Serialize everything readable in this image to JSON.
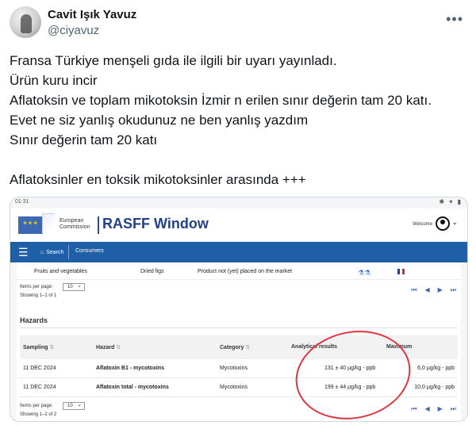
{
  "tweet": {
    "display_name": "Cavit Işık Yavuz",
    "handle": "@ciyavuz",
    "more_icon": "more-horizontal-icon",
    "text_lines": [
      "Fransa Türkiye menşeli gıda ile ilgili bir uyarı yayınladı.",
      "Ürün kuru incir",
      "Aflatoksin ve toplam mikotoksin İzmir n erilen sınır değerin tam 20 katı.",
      "Evet ne siz yanlış okudunuz ne ben yanlış yazdım",
      "Sınır değerin tam 20 katı",
      "",
      "Aflatoksinler en toksik mikotoksinler arasında +++"
    ]
  },
  "screenshot": {
    "status_time": "01:31",
    "status_icons": "✱ ▾ ▮",
    "ec_logo_line1": "European",
    "ec_logo_line2": "Commission",
    "app_title": "RASFF Window",
    "welcome": "Welcome",
    "nav": {
      "search": "Search",
      "consumers": "Consumers"
    },
    "product_row": {
      "category": "Fruits and vegetables",
      "product": "Dried figs",
      "distribution": "Product not (yet) placed on the market"
    },
    "pager_top": {
      "items_per_page_label": "Items per page:",
      "items_per_page_value": "10",
      "showing": "Showing 1–1 of 1"
    },
    "hazards_title": "Hazards",
    "table": {
      "columns": [
        "Sampling",
        "Hazard",
        "Category",
        "Analytical results",
        "Maximum"
      ],
      "rows": [
        {
          "sampling": "11 DEC 2024",
          "hazard": "Aflatoxin B1 - mycotoxins",
          "category": "Mycotoxins",
          "result": "131 ± 40 µg/kg - ppb",
          "maximum": "6,0 µg/kg - ppb"
        },
        {
          "sampling": "11 DEC 2024",
          "hazard": "Aflatoxin total - mycotoxins",
          "category": "Mycotoxins",
          "result": "199 ± 44 µg/kg - ppb",
          "maximum": "10,0 µg/kg - ppb"
        }
      ]
    },
    "pager_bottom": {
      "items_per_page_label": "Items per page:",
      "items_per_page_value": "10",
      "showing": "Showing 1–2 of 2"
    },
    "colors": {
      "nav_blue": "#1f5fa8",
      "title_blue": "#22408a",
      "annotation_red": "#e0353f"
    }
  }
}
